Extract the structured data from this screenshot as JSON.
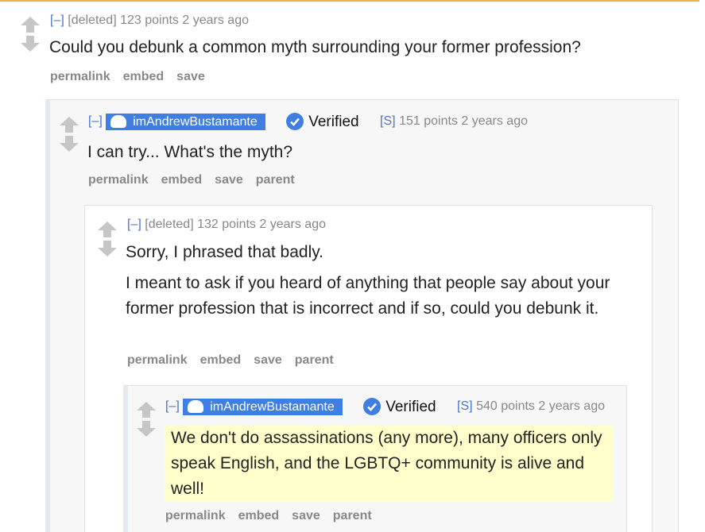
{
  "actions": {
    "permalink": "permalink",
    "embed": "embed",
    "save": "save",
    "parent": "parent"
  },
  "comments": [
    {
      "collapse": "[–]",
      "author": "[deleted]",
      "points": "123 points",
      "age": "2 years ago",
      "body": [
        "Could you debunk a common myth surrounding your former profession?"
      ]
    },
    {
      "collapse": "[–]",
      "author": "imAndrewBustamante",
      "verified": "Verified",
      "flair_open": "[",
      "flair": "S",
      "flair_close": "]",
      "points": "151 points",
      "age": "2 years ago",
      "body": [
        "I can try... What's the myth?"
      ]
    },
    {
      "collapse": "[–]",
      "author": "[deleted]",
      "points": "132 points",
      "age": "2 years ago",
      "body": [
        "Sorry, I phrased that badly.",
        "I meant to ask if you heard of anything that people say about your former profession that is incorrect and if so, could you debunk it."
      ]
    },
    {
      "collapse": "[–]",
      "author": "imAndrewBustamante",
      "verified": "Verified",
      "flair_open": "[",
      "flair": "S",
      "flair_close": "]",
      "points": "540 points",
      "age": "2 years ago",
      "body": [
        "We don't do assassinations (any more), many officers only speak English, and the LGBTQ+ community is alive and well!"
      ]
    }
  ],
  "colors": {
    "accent": "#3f7ee2",
    "link": "#4a74c9",
    "highlight": "#ffffcc",
    "topbar": "#f0b343"
  }
}
